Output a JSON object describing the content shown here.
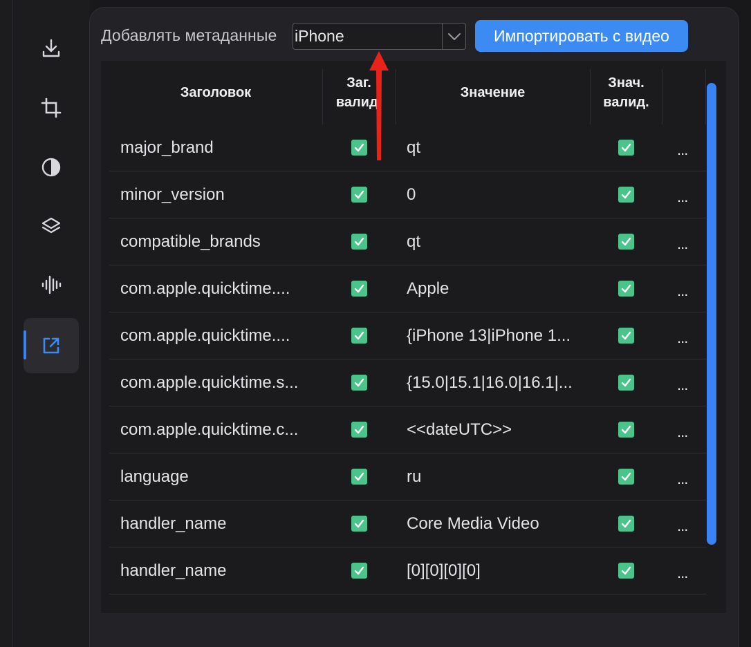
{
  "sidebar": {
    "items": [
      {
        "icon": "download-icon",
        "active": false
      },
      {
        "icon": "crop-icon",
        "active": false
      },
      {
        "icon": "contrast-icon",
        "active": false
      },
      {
        "icon": "layers-icon",
        "active": false
      },
      {
        "icon": "audio-waveform-icon",
        "active": false
      },
      {
        "icon": "external-link-icon",
        "active": true
      }
    ],
    "accent_color": "#3b82f6"
  },
  "toolbar": {
    "label": "Добавлять метаданные",
    "preset_select": {
      "value": "iPhone"
    },
    "import_button": "Импортировать с видео",
    "button_color": "#3b8bf2"
  },
  "table": {
    "headers": {
      "key": "Заголовок",
      "key_valid": "Заг.\nвалид.",
      "value": "Значение",
      "value_valid": "Знач.\nвалид."
    },
    "rows": [
      {
        "key": "major_brand",
        "key_valid": true,
        "value": "qt",
        "value_valid": true,
        "more": "..."
      },
      {
        "key": "minor_version",
        "key_valid": true,
        "value": "0",
        "value_valid": true,
        "more": "..."
      },
      {
        "key": "compatible_brands",
        "key_valid": true,
        "value": "qt",
        "value_valid": true,
        "more": "..."
      },
      {
        "key": "com.apple.quicktime....",
        "key_valid": true,
        "value": "Apple",
        "value_valid": true,
        "more": "..."
      },
      {
        "key": "com.apple.quicktime....",
        "key_valid": true,
        "value": "{iPhone 13|iPhone 1...",
        "value_valid": true,
        "more": "..."
      },
      {
        "key": "com.apple.quicktime.s...",
        "key_valid": true,
        "value": "{15.0|15.1|16.0|16.1|...",
        "value_valid": true,
        "more": "..."
      },
      {
        "key": "com.apple.quicktime.c...",
        "key_valid": true,
        "value": "<<dateUTC>>",
        "value_valid": true,
        "more": "..."
      },
      {
        "key": "language",
        "key_valid": true,
        "value": "ru",
        "value_valid": true,
        "more": "..."
      },
      {
        "key": "handler_name",
        "key_valid": true,
        "value": "Core Media Video",
        "value_valid": true,
        "more": "..."
      },
      {
        "key": "handler_name",
        "key_valid": true,
        "value": "[0][0][0][0]",
        "value_valid": true,
        "more": "..."
      }
    ],
    "checkbox_color": "#4cc38a"
  },
  "annotation": {
    "type": "arrow",
    "color": "#e8231a",
    "points_to": "preset_select"
  }
}
